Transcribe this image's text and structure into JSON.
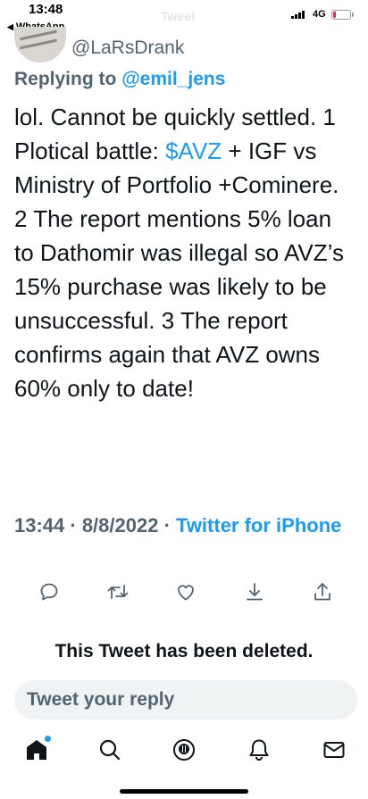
{
  "status_bar": {
    "time": "13:48",
    "back_app": "WhatsApp",
    "faded_title": "Tweet",
    "network": "4G"
  },
  "tweet": {
    "handle": "@LaRsDrank",
    "replying_label": "Replying to",
    "replying_mention": "@emil_jens",
    "text_before_cashtag": "lol. Cannot be quickly settled. 1 Plotical battle: ",
    "cashtag": "$AVZ",
    "text_after_cashtag": " + IGF vs Ministry of Portfolio +Cominere. 2 The report mentions 5% loan to Dathomir was illegal so AVZ’s 15% purchase was likely to be unsuccessful. 3 The report confirms again that AVZ owns 60% only to date!",
    "timestamp": "13:44 · 8/8/2022 · ",
    "source": "Twitter for iPhone"
  },
  "actions": [
    "reply-icon",
    "retweet-icon",
    "like-icon",
    "bookmark-icon",
    "share-icon"
  ],
  "deleted_notice": "This Tweet has been deleted.",
  "reply_box": {
    "placeholder": "Tweet your reply"
  },
  "tab_bar": [
    "home-icon",
    "search-icon",
    "spaces-icon",
    "notifications-icon",
    "messages-icon"
  ],
  "colors": {
    "accent": "#1d9bf0",
    "text": "#0f1419",
    "secondary": "#536471",
    "reply_bg": "#eff3f4"
  }
}
